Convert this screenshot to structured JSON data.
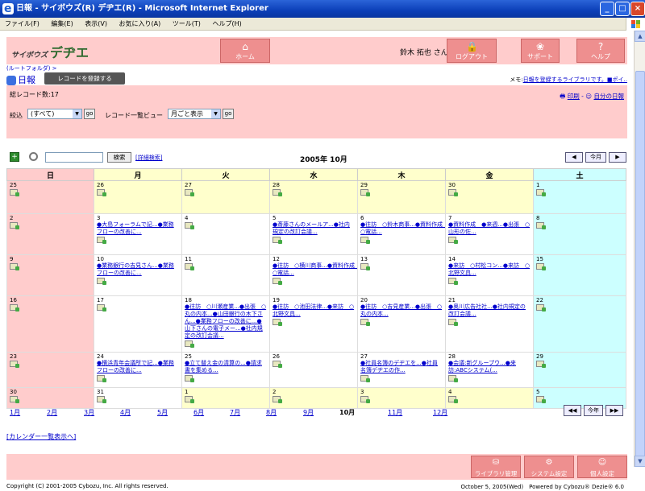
{
  "window": {
    "title": "日報 - サイボウズ(R) デヂエ(R) - Microsoft Internet Explorer",
    "minimize": "_",
    "maximize": "□",
    "close": "×"
  },
  "menubar": [
    "ファイル(F)",
    "編集(E)",
    "表示(V)",
    "お気に入り(A)",
    "ツール(T)",
    "ヘルプ(H)"
  ],
  "header": {
    "logo_text": "サイボウズ",
    "product": "デヂエ",
    "home": "ホーム",
    "home_icon": "⌂",
    "user": "鈴木 拓也 さん",
    "logout": "ログアウト",
    "logout_icon": "🔒",
    "support": "サポート",
    "support_icon": "❀",
    "help": "ヘルプ",
    "help_icon": "?"
  },
  "breadcrumb": "(ルートフォルダ) >",
  "app_title": "日報",
  "register_button": "レコードを登録する",
  "memo": {
    "label": "メモ:",
    "link": "日報を登録するライブラリです。■ポイ.."
  },
  "info": {
    "count": "総レコード数:17",
    "print": "印刷",
    "separator": "-",
    "my_report": "自分の日報",
    "filter_label": "絞込",
    "filter_value": "(すべて)",
    "go": "go",
    "view_label": "レコード一覧ビュー",
    "view_value": "月ごと表示",
    "arrow": "▼"
  },
  "search": {
    "new_icon": "+",
    "button": "検索",
    "advanced": "[詳細検索]",
    "month": "2005年 10月",
    "prev": "◀",
    "this_month": "今月",
    "next": "▶"
  },
  "calendar": {
    "weekdays": [
      "日",
      "月",
      "火",
      "水",
      "木",
      "金",
      "土"
    ],
    "weeks": [
      [
        {
          "d": "25",
          "o": true
        },
        {
          "d": "26",
          "o": true
        },
        {
          "d": "27",
          "o": true
        },
        {
          "d": "28",
          "o": true
        },
        {
          "d": "29",
          "o": true
        },
        {
          "d": "30",
          "o": true
        },
        {
          "d": "1"
        }
      ],
      [
        {
          "d": "2"
        },
        {
          "d": "3",
          "ev": "●大島フォーラムで記...●業務フローの改善に..."
        },
        {
          "d": "4"
        },
        {
          "d": "5",
          "ev": "●斎藤さんのメールア...●社内規定の改訂会議..."
        },
        {
          "d": "6",
          "ev": "●往訪　○鈴木商事...●資料作成　○電話..."
        },
        {
          "d": "7",
          "ev": "●資料作成　●来週...●出張　○山形の佐..."
        },
        {
          "d": "8"
        }
      ],
      [
        {
          "d": "9"
        },
        {
          "d": "10",
          "ev": "●業務銀行の吉見さん...●業務フローの改善に..."
        },
        {
          "d": "11"
        },
        {
          "d": "12",
          "ev": "●往訪　○横川商事...●資料作成　○電話..."
        },
        {
          "d": "13"
        },
        {
          "d": "14",
          "ev": "●来訪　○村松コン...●来訪　○北野文具..."
        },
        {
          "d": "15"
        }
      ],
      [
        {
          "d": "16"
        },
        {
          "d": "17"
        },
        {
          "d": "18",
          "ev": "●往訪　○川瀬産業...●出張　○丸の内本...●山田銀行の木下さん...●業務フローの改善に...●山下さんの電子メー...●社内規定の改訂会議..."
        },
        {
          "d": "19",
          "ev": "●往訪　○池田法律...●来訪　○北野文具..."
        },
        {
          "d": "20",
          "ev": "●往訪　○吉見産業...●出張　○丸の内本..."
        },
        {
          "d": "21",
          "ev": "●奥川広告社社...●社内規定の改訂会議..."
        },
        {
          "d": "22"
        }
      ],
      [
        {
          "d": "23"
        },
        {
          "d": "24",
          "ev": "●横浜青年会議所で記...●業務フローの改善に..."
        },
        {
          "d": "25",
          "ev": "●立て替え金の清算の...●請求書を集める..."
        },
        {
          "d": "26"
        },
        {
          "d": "27",
          "ev": "●社員名簿のデヂエを...●社員名簿デヂエの作..."
        },
        {
          "d": "28",
          "ev": "●会議:新グループウ...●来訪:ABCシステム(..."
        },
        {
          "d": "29"
        }
      ],
      [
        {
          "d": "30"
        },
        {
          "d": "31"
        },
        {
          "d": "1",
          "o": true
        },
        {
          "d": "2",
          "o": true
        },
        {
          "d": "3",
          "o": true
        },
        {
          "d": "4",
          "o": true
        },
        {
          "d": "5",
          "o": true
        }
      ]
    ]
  },
  "months": [
    "1月",
    "2月",
    "3月",
    "4月",
    "5月",
    "6月",
    "7月",
    "8月",
    "9月",
    "10月",
    "11月",
    "12月"
  ],
  "current_month_index": 9,
  "year_nav": {
    "prev": "◀◀",
    "this_year": "今年",
    "next": "▶▶"
  },
  "calendar_list_link": "[カレンダー一覧表示へ]",
  "footer": {
    "library_admin": "ライブラリ管理",
    "system_settings": "システム設定",
    "personal_settings": "個人設定",
    "copyright": "Copyright (C) 2001-2005 Cybozu, Inc. All rights reserved.",
    "date_powered": "October 5, 2005(Wed)　Powered by Cybozu® Dezie® 6.0"
  },
  "colors": {
    "header_pink": "#ffcccc",
    "button_pink": "#ee8f8f",
    "link_blue": "#0000cc",
    "sat_cyan": "#ccffff",
    "other_month": "#ffffcc"
  }
}
